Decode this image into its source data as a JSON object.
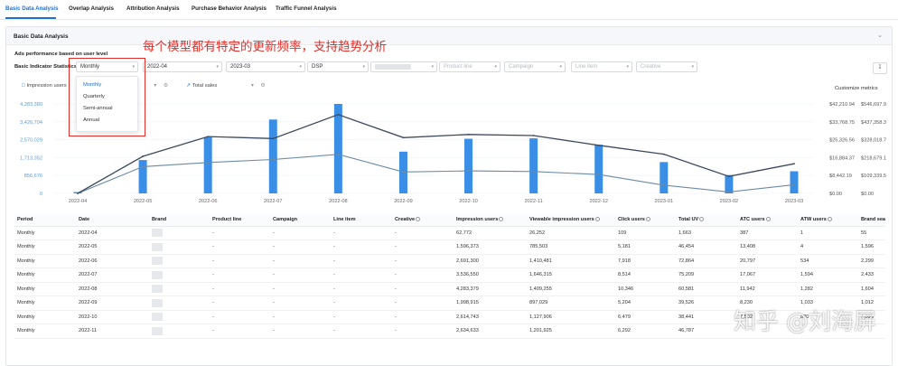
{
  "tabs": [
    "Basic Data Analysis",
    "Overlap Analysis",
    "Attribution Analysis",
    "Purchase Behavior Analysis",
    "Traffic Funnel Analysis"
  ],
  "panel": {
    "title": "Basic Data Analysis"
  },
  "annotation": "每个模型都有特定的更新频率，支持趋势分析",
  "section_label": "Ads performance based on user level",
  "filter_label": "Basic Indicator Statistics",
  "filters": {
    "period": "Monthly",
    "start_month": "2022-04",
    "end_month": "2023-03",
    "channel": "DSP",
    "product_line_placeholder": "Product line",
    "campaign_placeholder": "Campaign",
    "line_item_placeholder": "Line item",
    "creative_placeholder": "Creative"
  },
  "period_options": [
    "Monthly",
    "Quarterly",
    "Semi-annual",
    "Annual"
  ],
  "metric_left": "Impression users",
  "metric_right": "Total sales",
  "customize_label": "Customize metrics",
  "colors": {
    "accent": "#1f6fd6",
    "bar": "#3a8ee6",
    "line_dark": "#3c4a5c",
    "line_light": "#6b8aa6",
    "annotation": "#e52d27"
  },
  "chart_data": {
    "type": "bar",
    "categories": [
      "2022-04",
      "2022-05",
      "2022-06",
      "2022-07",
      "2022-08",
      "2022-09",
      "2022-10",
      "2022-11",
      "2022-12",
      "2023-01",
      "2023-02",
      "2023-03"
    ],
    "series": [
      {
        "name": "Impression users",
        "type": "bar",
        "axis": "left",
        "values": [
          62772,
          1596373,
          2691300,
          3536550,
          4283379,
          1998915,
          2614743,
          2634633,
          2330000,
          1500000,
          880000,
          1060000
        ]
      },
      {
        "name": "Total sales",
        "type": "line",
        "axis": "right",
        "values": [
          0,
          12600,
          14600,
          16000,
          18400,
          10100,
          10600,
          10300,
          8900,
          3900,
          700,
          4100
        ]
      },
      {
        "name": "",
        "type": "line",
        "axis": "right",
        "values": [
          0,
          17500,
          26800,
          25900,
          37200,
          26300,
          27800,
          27300,
          22700,
          18500,
          8000,
          14000
        ]
      }
    ],
    "left_ticks": [
      "0",
      "856,676",
      "1,713,352",
      "2,570,029",
      "3,426,704",
      "4,283,380"
    ],
    "right_ticks_a": [
      "$0.00",
      "$8,442.19",
      "$16,884.37",
      "$25,326.56",
      "$33,768.75",
      "$42,210.94"
    ],
    "right_ticks_b": [
      "$0.00",
      "$109,339.5",
      "$218,679.1",
      "$328,018.7",
      "$437,358.3",
      "$546,697.9"
    ],
    "ylim_left": [
      0,
      4283380
    ],
    "ylim_right": [
      0,
      42210.94
    ]
  },
  "table": {
    "columns": [
      "Period",
      "Date",
      "Brand",
      "Product line",
      "Campaign",
      "Line item",
      "Creative",
      "Impression users",
      "Viewable impression users",
      "Click users",
      "Total UV",
      "ATC users",
      "ATW users",
      "Brand sear"
    ],
    "rows": [
      [
        "Monthly",
        "2022-04",
        "",
        "-",
        "-",
        "-",
        "-",
        "62,772",
        "26,252",
        "109",
        "1,663",
        "387",
        "1",
        "55"
      ],
      [
        "Monthly",
        "2022-05",
        "",
        "-",
        "-",
        "-",
        "-",
        "1,596,373",
        "785,503",
        "5,181",
        "46,454",
        "13,408",
        "4",
        "1,596"
      ],
      [
        "Monthly",
        "2022-06",
        "",
        "-",
        "-",
        "-",
        "-",
        "2,691,300",
        "1,410,481",
        "7,918",
        "72,864",
        "20,797",
        "534",
        "2,299"
      ],
      [
        "Monthly",
        "2022-07",
        "",
        "-",
        "-",
        "-",
        "-",
        "3,536,550",
        "1,646,315",
        "8,514",
        "75,209",
        "17,067",
        "1,594",
        "2,433"
      ],
      [
        "Monthly",
        "2022-08",
        "",
        "-",
        "-",
        "-",
        "-",
        "4,283,379",
        "1,409,255",
        "10,346",
        "60,581",
        "11,942",
        "1,282",
        "1,604"
      ],
      [
        "Monthly",
        "2022-09",
        "",
        "-",
        "-",
        "-",
        "-",
        "1,998,915",
        "897,029",
        "5,204",
        "39,526",
        "8,230",
        "1,033",
        "1,012"
      ],
      [
        "Monthly",
        "2022-10",
        "",
        "-",
        "-",
        "-",
        "-",
        "2,614,743",
        "1,127,906",
        "6,479",
        "38,441",
        "7,502",
        "870",
        "1,093"
      ],
      [
        "Monthly",
        "2022-11",
        "",
        "-",
        "-",
        "-",
        "-",
        "2,634,633",
        "1,201,925",
        "6,292",
        "46,787",
        "",
        "",
        ""
      ]
    ]
  },
  "watermark": "知乎 @刘海屏"
}
